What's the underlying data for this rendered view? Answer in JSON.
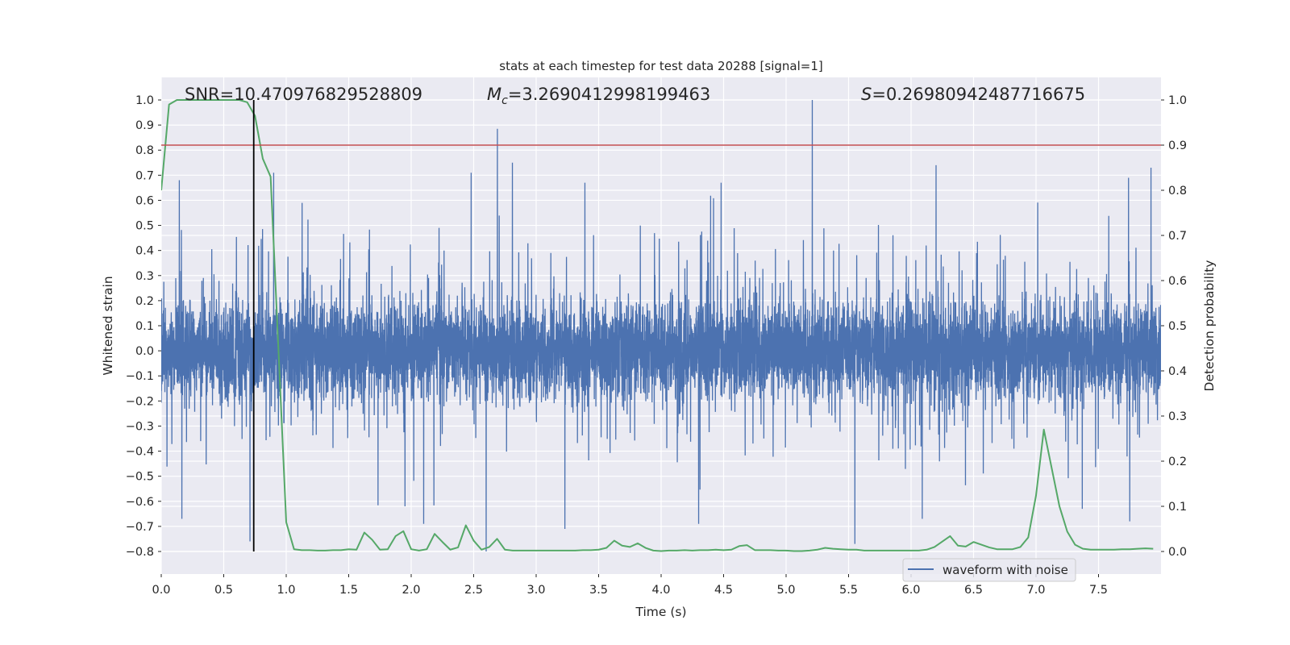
{
  "chart_data": {
    "type": "line",
    "title": "stats at each timestep for test data 20288 [signal=1]",
    "xlabel": "Time (s)",
    "ylabel": "Whitened strain",
    "ylabel_right": "Detection probability",
    "xlim": [
      0,
      8
    ],
    "ylim": [
      -0.89,
      1.09
    ],
    "ylim_right": [
      -0.05,
      1.05
    ],
    "xticks": [
      "0.0",
      "0.5",
      "1.0",
      "1.5",
      "2.0",
      "2.5",
      "3.0",
      "3.5",
      "4.0",
      "4.5",
      "5.0",
      "5.5",
      "6.0",
      "6.5",
      "7.0",
      "7.5"
    ],
    "yticks": [
      "1.0",
      "0.9",
      "0.8",
      "0.7",
      "0.6",
      "0.5",
      "0.4",
      "0.3",
      "0.2",
      "0.1",
      "0.0",
      "−0.1",
      "−0.2",
      "−0.3",
      "−0.4",
      "−0.5",
      "−0.6",
      "−0.7",
      "−0.8"
    ],
    "yticks_right": [
      "1.0",
      "0.9",
      "0.8",
      "0.7",
      "0.6",
      "0.5",
      "0.4",
      "0.3",
      "0.2",
      "0.1",
      "0.0"
    ],
    "grid": true,
    "background": "#EAEAF2",
    "legend": {
      "position": "lower right",
      "entries": [
        "waveform with noise"
      ]
    },
    "annotations": {
      "snr": "SNR=10.470976829528809",
      "mc_symbol": "M",
      "mc_sub": "c",
      "mc_value": "=3.2690412998199463",
      "s_symbol": "S",
      "s_value": "=0.26980942487716675"
    },
    "series": [
      {
        "name": "waveform with noise",
        "axis": "left",
        "color": "#4C72B0",
        "x_range": [
          0,
          8
        ],
        "typical_band": [
          -0.27,
          0.27
        ],
        "notable_extremes": [
          [
            5.21,
            1.0
          ],
          [
            2.69,
            0.885
          ],
          [
            2.81,
            0.75
          ],
          [
            2.48,
            0.71
          ],
          [
            0.9,
            0.71
          ],
          [
            0.145,
            0.68
          ],
          [
            7.92,
            0.73
          ],
          [
            6.2,
            0.74
          ],
          [
            7.74,
            0.69
          ],
          [
            4.48,
            0.67
          ],
          [
            3.39,
            0.67
          ],
          [
            2.6,
            -0.8
          ],
          [
            5.55,
            -0.77
          ],
          [
            0.71,
            -0.76
          ],
          [
            0.165,
            -0.67
          ],
          [
            3.23,
            -0.71
          ],
          [
            4.3,
            -0.69
          ],
          [
            6.09,
            -0.67
          ],
          [
            7.75,
            -0.68
          ],
          [
            2.1,
            -0.69
          ],
          [
            7.37,
            -0.63
          ]
        ]
      },
      {
        "axis": "right",
        "color": "#55A868",
        "x": [
          0,
          0.0625,
          0.125,
          0.1875,
          0.25,
          0.3125,
          0.375,
          0.4375,
          0.5,
          0.5625,
          0.625,
          0.6875,
          0.75,
          0.8125,
          0.875,
          0.9375,
          1,
          1.0625,
          1.125,
          1.1875,
          1.25,
          1.3125,
          1.375,
          1.4375,
          1.5,
          1.5625,
          1.625,
          1.6875,
          1.75,
          1.8125,
          1.875,
          1.9375,
          2,
          2.0625,
          2.125,
          2.1875,
          2.25,
          2.3125,
          2.375,
          2.4375,
          2.5,
          2.5625,
          2.625,
          2.6875,
          2.75,
          2.8125,
          2.875,
          2.9375,
          3,
          3.0625,
          3.125,
          3.1875,
          3.25,
          3.3125,
          3.375,
          3.4375,
          3.5,
          3.5625,
          3.625,
          3.6875,
          3.75,
          3.8125,
          3.875,
          3.9375,
          4,
          4.0625,
          4.125,
          4.1875,
          4.25,
          4.3125,
          4.375,
          4.4375,
          4.5,
          4.5625,
          4.625,
          4.6875,
          4.75,
          4.8125,
          4.875,
          4.9375,
          5,
          5.0625,
          5.125,
          5.1875,
          5.25,
          5.3125,
          5.375,
          5.4375,
          5.5,
          5.5625,
          5.625,
          5.6875,
          5.75,
          5.8125,
          5.875,
          5.9375,
          6,
          6.0625,
          6.125,
          6.1875,
          6.25,
          6.3125,
          6.375,
          6.4375,
          6.5,
          6.5625,
          6.625,
          6.6875,
          6.75,
          6.8125,
          6.875,
          6.9375,
          7,
          7.0625,
          7.125,
          7.1875,
          7.25,
          7.3125,
          7.375,
          7.4375,
          7.5,
          7.5625,
          7.625,
          7.6875,
          7.75,
          7.8125,
          7.875,
          7.9375
        ],
        "values": [
          0.8,
          0.99,
          1.0,
          1.0,
          1.0,
          1.0,
          1.0,
          1.0,
          1.0,
          1.0,
          1.0,
          0.995,
          0.965,
          0.87,
          0.83,
          0.45,
          0.065,
          0.005,
          0.003,
          0.003,
          0.002,
          0.002,
          0.003,
          0.003,
          0.005,
          0.004,
          0.042,
          0.026,
          0.004,
          0.005,
          0.034,
          0.045,
          0.005,
          0.002,
          0.005,
          0.039,
          0.021,
          0.004,
          0.009,
          0.058,
          0.024,
          0.004,
          0.01,
          0.028,
          0.004,
          0.002,
          0.002,
          0.002,
          0.002,
          0.002,
          0.002,
          0.002,
          0.002,
          0.002,
          0.003,
          0.003,
          0.004,
          0.008,
          0.024,
          0.013,
          0.01,
          0.018,
          0.008,
          0.002,
          0.001,
          0.002,
          0.002,
          0.003,
          0.002,
          0.003,
          0.003,
          0.004,
          0.003,
          0.004,
          0.012,
          0.014,
          0.003,
          0.003,
          0.003,
          0.002,
          0.002,
          0.001,
          0.001,
          0.002,
          0.004,
          0.008,
          0.006,
          0.005,
          0.004,
          0.004,
          0.002,
          0.002,
          0.002,
          0.002,
          0.002,
          0.002,
          0.002,
          0.002,
          0.004,
          0.01,
          0.022,
          0.034,
          0.013,
          0.011,
          0.021,
          0.015,
          0.009,
          0.005,
          0.005,
          0.005,
          0.01,
          0.031,
          0.124,
          0.27,
          0.185,
          0.1,
          0.044,
          0.015,
          0.006,
          0.004,
          0.004,
          0.004,
          0.004,
          0.005,
          0.005,
          0.006,
          0.007,
          0.006
        ]
      }
    ],
    "threshold_line": {
      "y": 0.9,
      "axis": "right",
      "color": "#C44E52"
    },
    "marker_line": {
      "x": 0.74,
      "ymin": 0,
      "ymax": 1,
      "axis": "right",
      "color": "#000000"
    }
  }
}
